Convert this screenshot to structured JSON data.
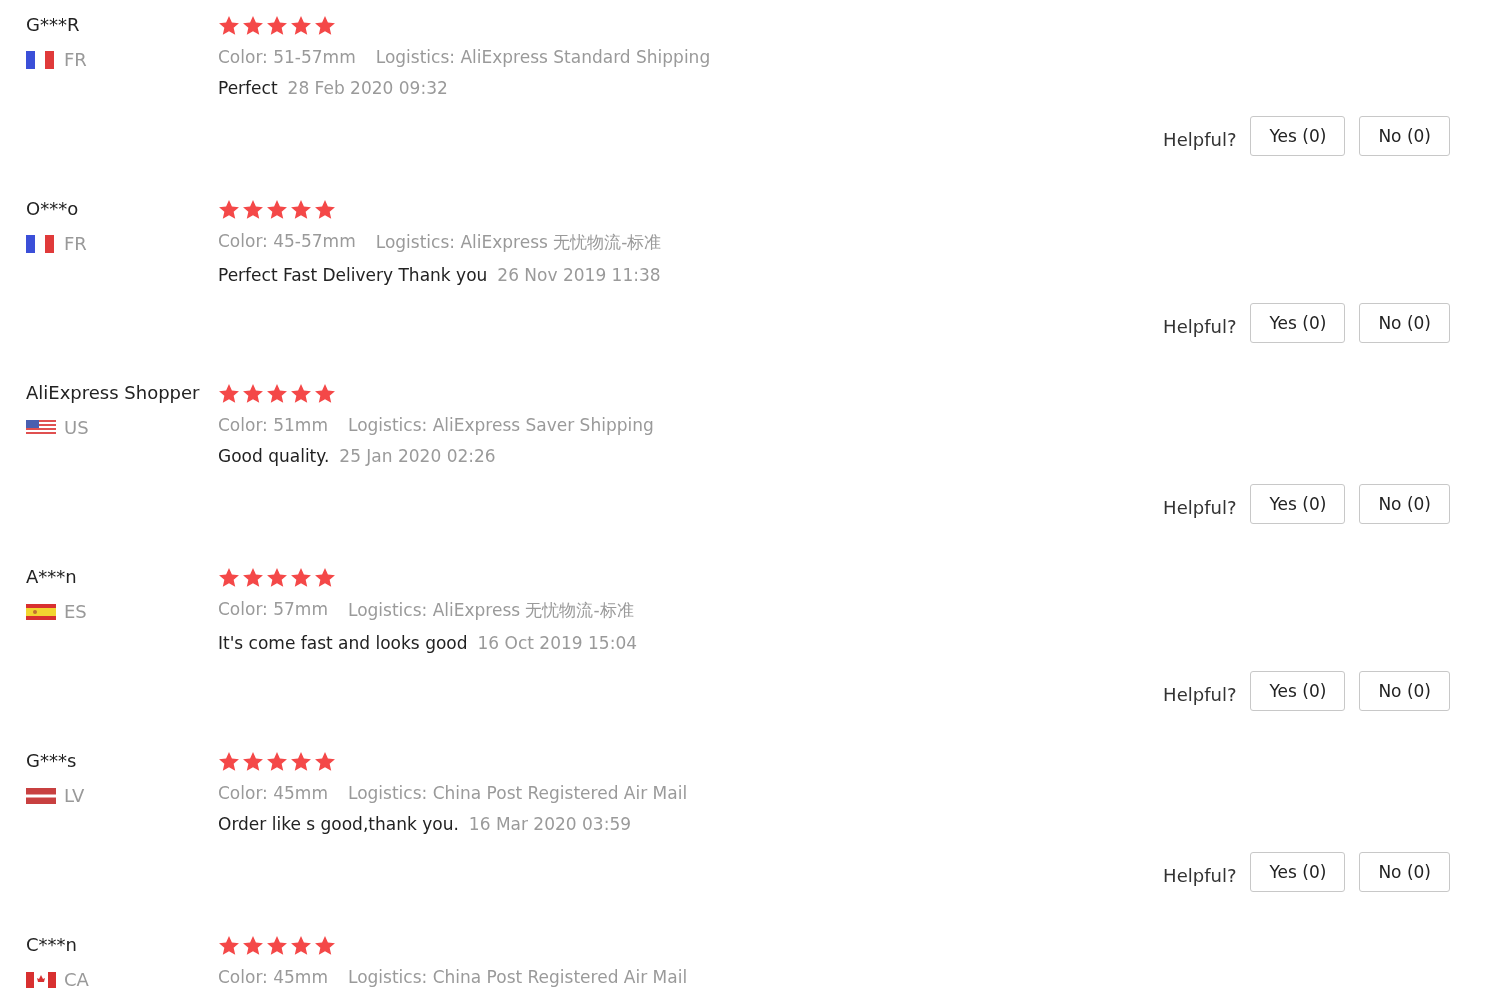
{
  "reviews": [
    {
      "name": "G***R",
      "country": {
        "code": "FR",
        "kind": "vertical-tricolor"
      },
      "stars": 5,
      "sku": "Color: 51-57mm",
      "logistics": "Logistics: AliExpress Standard Shipping",
      "text": "Perfect",
      "date": "28 Feb 2020 09:32",
      "helpful": "Helpful?",
      "yes": "Yes (0)",
      "no": "No (0)"
    },
    {
      "name": "O***o",
      "country": {
        "code": "FR",
        "kind": "vertical-tricolor"
      },
      "stars": 5,
      "sku": "Color: 45-57mm",
      "logistics": "Logistics: AliExpress 无忧物流-标准",
      "text": "Perfect Fast Delivery Thank you",
      "date": "26 Nov 2019 11:38",
      "helpful": "Helpful?",
      "yes": "Yes (0)",
      "no": "No (0)"
    },
    {
      "name": "AliExpress Shopper",
      "country": {
        "code": "US",
        "kind": "stripes-canton"
      },
      "stars": 5,
      "sku": "Color: 51mm",
      "logistics": "Logistics: AliExpress Saver Shipping",
      "text": "Good quality.",
      "date": "25 Jan 2020 02:26",
      "helpful": "Helpful?",
      "yes": "Yes (0)",
      "no": "No (0)"
    },
    {
      "name": "A***n",
      "country": {
        "code": "ES",
        "kind": "horizontal-band"
      },
      "stars": 5,
      "sku": "Color: 57mm",
      "logistics": "Logistics: AliExpress 无忧物流-标准",
      "text": "It's come fast and looks good",
      "date": "16 Oct 2019 15:04",
      "helpful": "Helpful?",
      "yes": "Yes (0)",
      "no": "No (0)"
    },
    {
      "name": "G***s",
      "country": {
        "code": "LV",
        "kind": "horizontal-stripe"
      },
      "stars": 5,
      "sku": "Color: 45mm",
      "logistics": "Logistics: China Post Registered Air Mail",
      "text": "Order like s good,thank you.",
      "date": "16 Mar 2020 03:59",
      "helpful": "Helpful?",
      "yes": "Yes (0)",
      "no": "No (0)"
    },
    {
      "name": "C***n",
      "country": {
        "code": "CA",
        "kind": "leaf"
      },
      "stars": 5,
      "sku": "Color: 45mm",
      "logistics": "Logistics: China Post Registered Air Mail"
    }
  ]
}
